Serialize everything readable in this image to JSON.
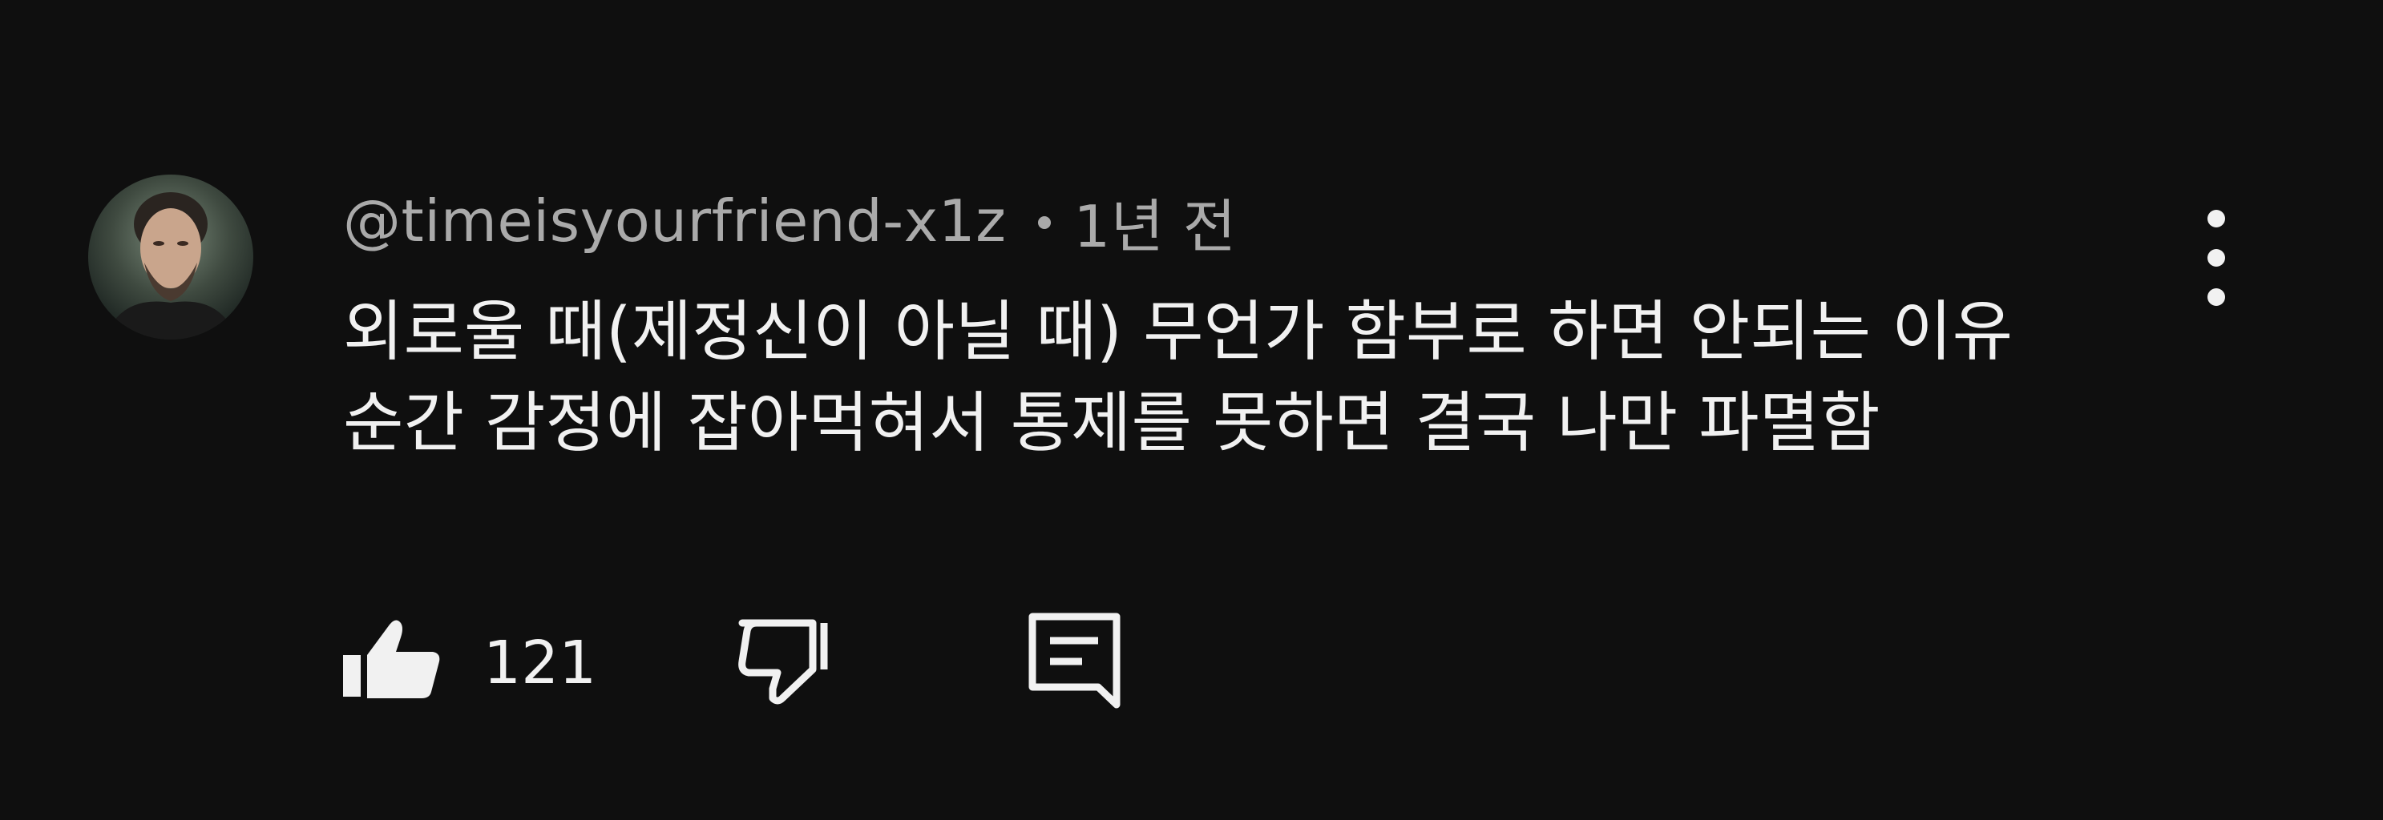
{
  "comment": {
    "author": "@timeisyourfriend-x1z",
    "time": "1년 전",
    "text_lines": [
      "외로울 때(제정신이 아닐 때) 무언가 함부로 하면 안되는 이유",
      "순간 감정에 잡아먹혀서 통제를 못하면 결국 나만 파멸함"
    ],
    "like_count": "121"
  },
  "icons": {
    "more": "more-vertical-icon",
    "like": "thumbs-up-icon",
    "dislike": "thumbs-down-icon",
    "reply": "reply-comment-icon"
  },
  "colors": {
    "background": "#0f0f0f",
    "primary_text": "#f1f1f1",
    "secondary_text": "#aaaaaa"
  }
}
